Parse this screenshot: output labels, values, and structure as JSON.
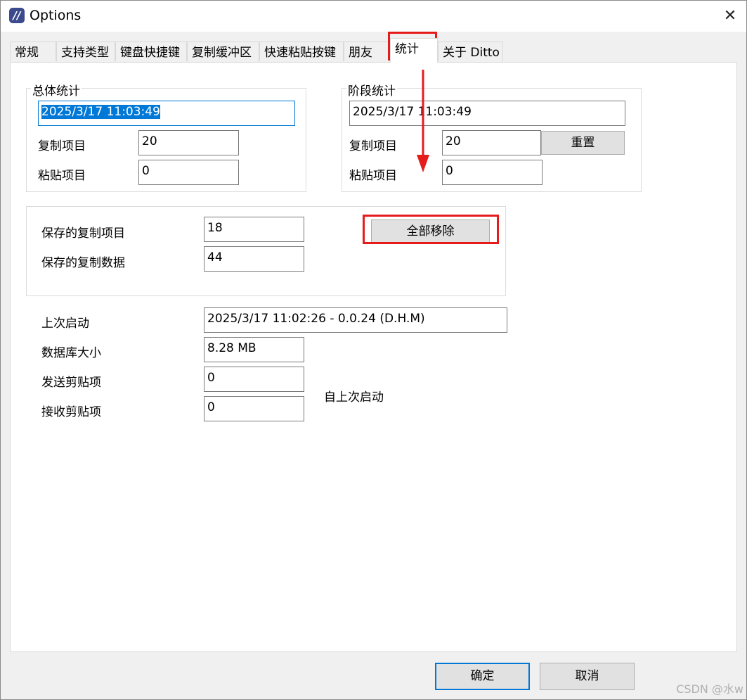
{
  "window": {
    "title": "Options",
    "close_glyph": "✕",
    "app_icon_glyph": "//"
  },
  "tabs": [
    {
      "label": "常规"
    },
    {
      "label": "支持类型"
    },
    {
      "label": "键盘快捷键"
    },
    {
      "label": "复制缓冲区"
    },
    {
      "label": "快速粘贴按键"
    },
    {
      "label": "朋友"
    },
    {
      "label": "统计",
      "active": true
    },
    {
      "label": "关于 Ditto"
    }
  ],
  "overall": {
    "title": "总体统计",
    "date": "2025/3/17 11:03:49",
    "copy_label": "复制项目",
    "copy_value": "20",
    "paste_label": "粘贴项目",
    "paste_value": "0"
  },
  "stage": {
    "title": "阶段统计",
    "date": "2025/3/17 11:03:49",
    "copy_label": "复制项目",
    "copy_value": "20",
    "paste_label": "粘贴项目",
    "paste_value": "0",
    "reset_label": "重置"
  },
  "saved": {
    "items_label": "保存的复制项目",
    "items_value": "18",
    "data_label": "保存的复制数据",
    "data_value": "44",
    "remove_all_label": "全部移除"
  },
  "info": {
    "last_start_label": "上次启动",
    "last_start_value": "2025/3/17 11:02:26  -  0.0.24 (D.H.M)",
    "db_size_label": "数据库大小",
    "db_size_value": "8.28 MB",
    "sent_label": "发送剪贴项",
    "sent_value": "0",
    "received_label": "接收剪贴项",
    "received_value": "0",
    "since_label": "自上次启动"
  },
  "footer": {
    "ok_label": "确定",
    "cancel_label": "取消"
  },
  "watermark": "CSDN @水w",
  "colors": {
    "annotation": "#e61c1c",
    "accent": "#0078d7"
  }
}
